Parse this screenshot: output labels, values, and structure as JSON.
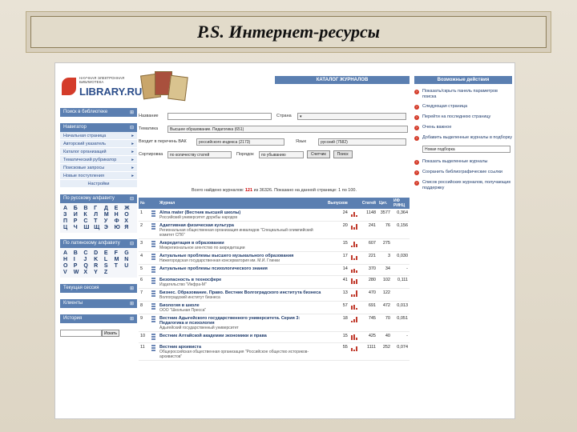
{
  "slide": {
    "title": "P.S. Интернет-ресурсы"
  },
  "logo": {
    "small_line1": "НАУЧНАЯ ЭЛЕКТРОННАЯ",
    "small_line2": "БИБЛИОТЕКА",
    "brand": "LIBRARY.RU"
  },
  "left": {
    "search_header": "Поиск в библиотеке",
    "navigator_header": "Навигатор",
    "nav_items": [
      "Начальная страница",
      "Авторский указатель",
      "Каталог организаций",
      "Тематический рубрикатор",
      "Поисковые запросы",
      "Новые поступления"
    ],
    "settings": "Настройки",
    "rus_header": "По русскому алфавиту",
    "rus_letters": [
      "А",
      "Б",
      "В",
      "Г",
      "Д",
      "Е",
      "Ж",
      "З",
      "И",
      "К",
      "Л",
      "М",
      "Н",
      "О",
      "П",
      "Р",
      "С",
      "Т",
      "У",
      "Ф",
      "Х",
      "Ц",
      "Ч",
      "Ш",
      "Щ",
      "Э",
      "Ю",
      "Я"
    ],
    "lat_header": "По латинскому алфавиту",
    "lat_letters": [
      "A",
      "B",
      "C",
      "D",
      "E",
      "F",
      "G",
      "H",
      "I",
      "J",
      "K",
      "L",
      "M",
      "N",
      "O",
      "P",
      "Q",
      "R",
      "S",
      "T",
      "U",
      "V",
      "W",
      "X",
      "Y",
      "Z"
    ],
    "session_header": "Текущая сессия",
    "clients_header": "Клиенты",
    "history_header": "История",
    "search_button": "Искать"
  },
  "main": {
    "catalog_title": "КАТАЛОГ ЖУРНАЛОВ",
    "form": {
      "name_label": "Название",
      "country_label": "Страна",
      "topic_label": "Тематика",
      "topic_value": "Высшее образование. Педагогика (651)",
      "vak_label": "Входит в перечень ВАК",
      "rinc_label": "российского индекса (2173)",
      "lang_label": "Язык",
      "lang_value": "русский (7582)",
      "sort_label": "Сортировка",
      "sort_value": "по количеству статей",
      "order_label": "Порядок",
      "order_value": "по убыванию",
      "count_button": "Счетчик",
      "search_button": "Поиск"
    },
    "found_text_pre": "Всего найдено журналов:",
    "found_count": "121",
    "found_total": "из 36326.",
    "found_text_post": "Показано на данной странице: 1 по 100.",
    "columns": [
      "№",
      "Журнал",
      "Выпусков",
      "Статей",
      "Цит.",
      "ИФ РИНЦ"
    ],
    "rows": [
      {
        "n": "1",
        "title": "Alma mater (Вестник высшей школы)",
        "sub": "Российский университет дружбы народов",
        "issues": "24",
        "articles": "1148",
        "cites": "3577",
        "if": "0,364"
      },
      {
        "n": "2",
        "title": "Адаптивная физическая культура",
        "sub": "Региональная общественная организация инвалидов \"Специальный олимпийский комитет СПб\"",
        "issues": "20",
        "articles": "241",
        "cites": "76",
        "if": "0,156"
      },
      {
        "n": "3",
        "title": "Аккредитация в образовании",
        "sub": "Межрегиональное агентство по аккредитации",
        "issues": "15",
        "articles": "607",
        "cites": "275",
        "if": ""
      },
      {
        "n": "4",
        "title": "Актуальные проблемы высшего музыкального образования",
        "sub": "Нижегородская государственная консерватория им. М.И. Глинки",
        "issues": "17",
        "articles": "221",
        "cites": "3",
        "if": "0,030"
      },
      {
        "n": "5",
        "title": "Актуальные проблемы психологического знания",
        "sub": "",
        "issues": "14",
        "articles": "370",
        "cites": "34",
        "if": "-"
      },
      {
        "n": "6",
        "title": "Безопасность в техносфере",
        "sub": "Издательство \"Инфра-М\"",
        "issues": "41",
        "articles": "280",
        "cites": "102",
        "if": "0,111"
      },
      {
        "n": "7",
        "title": "Бизнес. Образование. Право. Вестник Волгоградского института бизнеса",
        "sub": "Волгоградский институт бизнеса",
        "issues": "13",
        "articles": "470",
        "cites": "122",
        "if": ""
      },
      {
        "n": "8",
        "title": "Биология в школе",
        "sub": "ООО \"Школьная Пресса\"",
        "issues": "57",
        "articles": "691",
        "cites": "472",
        "if": "0,013"
      },
      {
        "n": "9",
        "title": "Вестник Адыгейского государственного университета. Серия 3: Педагогика и психология",
        "sub": "Адыгейский государственный университет",
        "issues": "18",
        "articles": "745",
        "cites": "70",
        "if": "0,051"
      },
      {
        "n": "10",
        "title": "Вестник Алтайской академии экономики и права",
        "sub": "",
        "issues": "15",
        "articles": "425",
        "cites": "40",
        "if": "-"
      },
      {
        "n": "11",
        "title": "Вестник архивиста",
        "sub": "Общероссийская общественная организация \"Российское общество историков-архивистов\"",
        "issues": "55",
        "articles": "1111",
        "cites": "252",
        "if": "0,074"
      }
    ]
  },
  "right": {
    "header": "Возможные действия",
    "actions": [
      "Показать/скрыть панель параметров поиска",
      "Следующая страница",
      "Перейти на последнюю страницу",
      "Очень важное",
      "Добавить выделенные журналы в подборку",
      "Показать выделенные журналы",
      "Сохранить библиографические ссылки",
      "Список российских журналов, получающих поддержку"
    ],
    "select_value": "Новая подборка"
  }
}
